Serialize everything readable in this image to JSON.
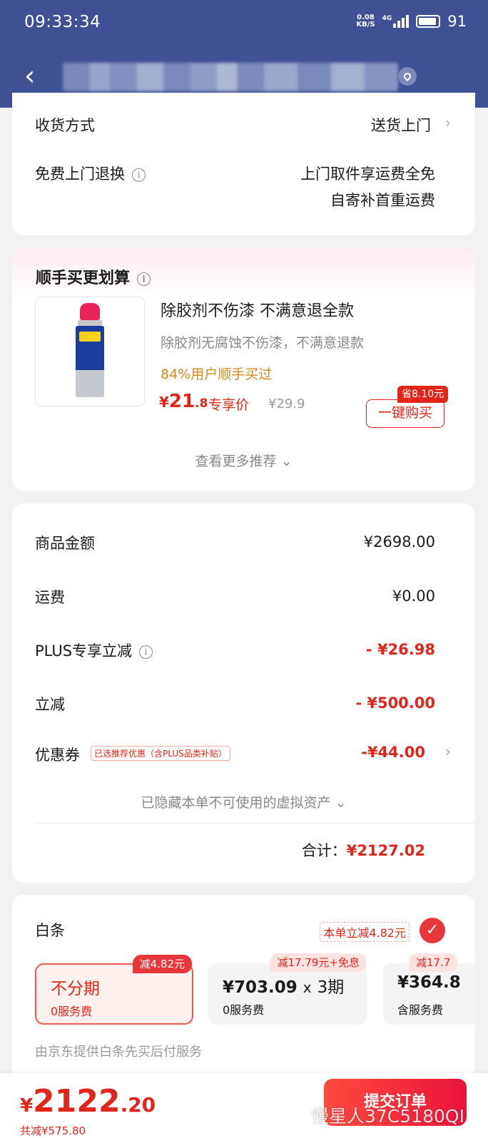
{
  "status_bar": {
    "time": "09:33:34",
    "net_speed_top": "0.08",
    "net_speed_bottom": "KB/S",
    "network": "4G",
    "battery": "91"
  },
  "header": {
    "address": ""
  },
  "delivery": {
    "method_label": "收货方式",
    "method_value": "送货上门",
    "return_label": "免费上门退换",
    "return_value_1": "上门取件享运费全免",
    "return_value_2": "自寄补首重运费"
  },
  "addon": {
    "title": "顺手买更划算",
    "product_name": "除胶剂不伤漆 不满意退全款",
    "product_desc": "除胶剂无腐蚀不伤漆，不满意退款",
    "buy_rate": "84%用户顺手买过",
    "price_symbol": "¥",
    "price_int": "21",
    "price_dec": ".8",
    "price_label": "专享价",
    "old_price": "¥29.9",
    "save_tag": "省8.10元",
    "buy_button": "一键购买",
    "more_link": "查看更多推荐"
  },
  "pricing": {
    "goods_label": "商品金额",
    "goods_value": "¥2698.00",
    "shipping_label": "运费",
    "shipping_value": "¥0.00",
    "plus_label": "PLUS专享立减",
    "plus_value": "- ¥26.98",
    "discount_label": "立减",
    "discount_value": "- ¥500.00",
    "coupon_label": "优惠券",
    "coupon_tag": "已选推荐优惠（含PLUS品类补贴）",
    "coupon_value": "-¥44.00",
    "hidden_note": "已隐藏本单不可使用的虚拟资产",
    "total_label": "合计：",
    "total_value": "¥2127.02"
  },
  "baitiao": {
    "title": "白条",
    "promo": "本单立减4.82元",
    "plans": [
      {
        "title": "不分期",
        "sub": "0服务费",
        "tag": "减4.82元"
      },
      {
        "title_amount": "¥703.09",
        "title_x": "x",
        "title_periods": "3期",
        "sub": "0服务费",
        "tag": "减17.79元+免息"
      },
      {
        "title": "¥364.8",
        "sub": "含服务费",
        "tag": "减17.7"
      }
    ],
    "footnote": "由京东提供白条先买后付服务"
  },
  "bottom_bar": {
    "price_symbol": "¥",
    "price_int": "2122",
    "price_dec": ".20",
    "total_saved": "共减¥575.80",
    "submit_button": "提交订单",
    "watermark": "慢星人37C5180QI"
  },
  "colors": {
    "header_bg": "#3e5195",
    "accent_red": "#e1251b"
  }
}
